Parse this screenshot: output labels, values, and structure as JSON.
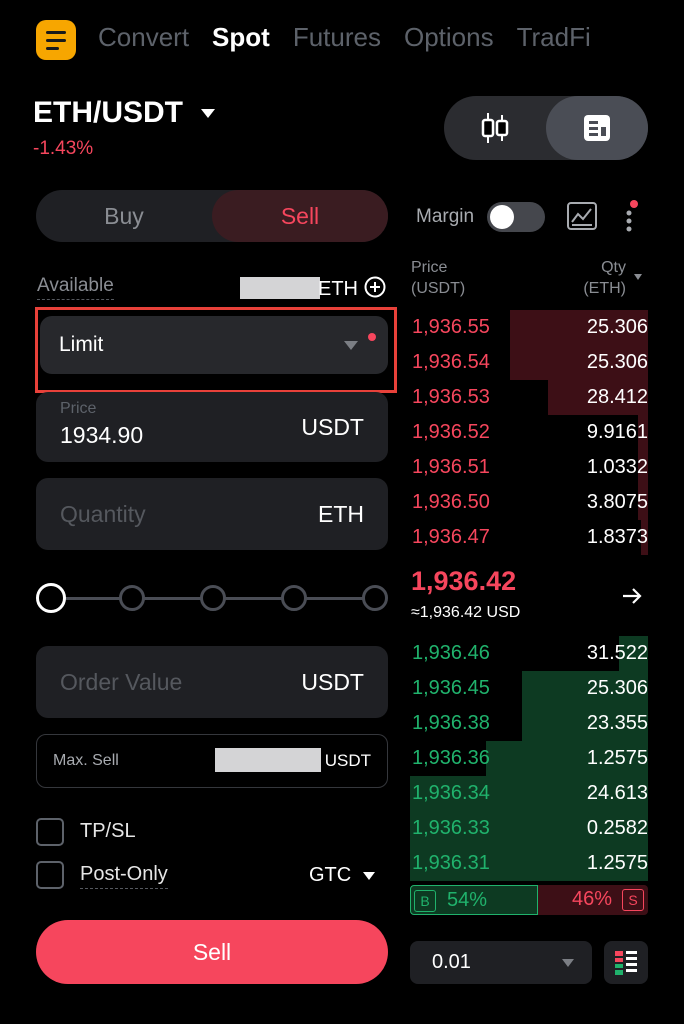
{
  "nav": {
    "tabs": [
      {
        "label": "Convert",
        "active": false
      },
      {
        "label": "Spot",
        "active": true
      },
      {
        "label": "Futures",
        "active": false
      },
      {
        "label": "Options",
        "active": false
      },
      {
        "label": "TradFi",
        "active": false
      }
    ]
  },
  "pair": {
    "symbol": "ETH/USDT",
    "change": "-1.43%"
  },
  "trade_side": {
    "buy_label": "Buy",
    "sell_label": "Sell",
    "selected": "Sell"
  },
  "margin": {
    "label": "Margin",
    "enabled": false
  },
  "available": {
    "label": "Available",
    "unit": "ETH"
  },
  "order_type": {
    "selected": "Limit"
  },
  "price_field": {
    "label": "Price",
    "value": "1934.90",
    "unit": "USDT"
  },
  "quantity_field": {
    "placeholder": "Quantity",
    "unit": "ETH"
  },
  "slider": {
    "value_percent": 0,
    "stops": [
      0,
      25,
      50,
      75,
      100
    ]
  },
  "order_value_field": {
    "placeholder": "Order Value",
    "unit": "USDT"
  },
  "max_sell": {
    "label": "Max. Sell",
    "unit": "USDT"
  },
  "options": {
    "tpsl_label": "TP/SL",
    "post_only_label": "Post-Only",
    "time_in_force": "GTC"
  },
  "submit": {
    "label": "Sell"
  },
  "orderbook": {
    "price_header": "Price",
    "price_unit": "(USDT)",
    "qty_header": "Qty",
    "qty_unit": "(ETH)",
    "asks": [
      {
        "price": "1,936.55",
        "qty": "25.306",
        "depth": 0.58
      },
      {
        "price": "1,936.54",
        "qty": "25.306",
        "depth": 0.58
      },
      {
        "price": "1,936.53",
        "qty": "28.412",
        "depth": 0.42
      },
      {
        "price": "1,936.52",
        "qty": "9.9161",
        "depth": 0.04
      },
      {
        "price": "1,936.51",
        "qty": "1.0332",
        "depth": 0.04
      },
      {
        "price": "1,936.50",
        "qty": "3.8075",
        "depth": 0.04
      },
      {
        "price": "1,936.47",
        "qty": "1.8373",
        "depth": 0.03
      }
    ],
    "last_price": "1,936.42",
    "last_price_usd": "≈1,936.42 USD",
    "bids": [
      {
        "price": "1,936.46",
        "qty": "31.522",
        "depth": 0.12
      },
      {
        "price": "1,936.45",
        "qty": "25.306",
        "depth": 0.53
      },
      {
        "price": "1,936.38",
        "qty": "23.355",
        "depth": 0.53
      },
      {
        "price": "1,936.36",
        "qty": "1.2575",
        "depth": 0.68
      },
      {
        "price": "1,936.34",
        "qty": "24.613",
        "depth": 1.0
      },
      {
        "price": "1,936.33",
        "qty": "0.2582",
        "depth": 1.0
      },
      {
        "price": "1,936.31",
        "qty": "1.2575",
        "depth": 1.0
      }
    ],
    "buy_ratio": "54%",
    "sell_ratio": "46%",
    "buy_badge": "B",
    "sell_badge": "S",
    "depth_step": "0.01"
  },
  "colors": {
    "accent": "#f7a600",
    "sell": "#f6465d",
    "buy": "#20b26c",
    "highlight": "#e8413a"
  },
  "icons": [
    "menu-icon",
    "candlestick-icon",
    "orderbook-view-icon",
    "chart-icon",
    "more-vertical-icon",
    "add-circle-icon",
    "arrow-right-icon",
    "orderbook-layout-icon"
  ]
}
